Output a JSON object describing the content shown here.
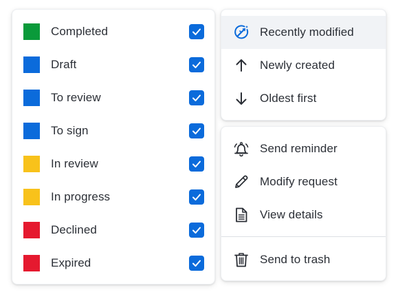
{
  "colors": {
    "green": "#0a9a3a",
    "blue": "#0b6bdb",
    "yellow": "#f8c21b",
    "red": "#e5192f",
    "checkbox": "#0b6bdb"
  },
  "status_filters": [
    {
      "label": "Completed",
      "color": "green",
      "checked": true
    },
    {
      "label": "Draft",
      "color": "blue",
      "checked": true
    },
    {
      "label": "To review",
      "color": "blue",
      "checked": true
    },
    {
      "label": "To sign",
      "color": "blue",
      "checked": true
    },
    {
      "label": "In review",
      "color": "yellow",
      "checked": true
    },
    {
      "label": "In progress",
      "color": "yellow",
      "checked": true
    },
    {
      "label": "Declined",
      "color": "red",
      "checked": true
    },
    {
      "label": "Expired",
      "color": "red",
      "checked": true
    }
  ],
  "sort_menu": {
    "items": [
      {
        "label": "Recently modified",
        "icon": "magic-wand-icon",
        "selected": true
      },
      {
        "label": "Newly created",
        "icon": "arrow-up-icon",
        "selected": false
      },
      {
        "label": "Oldest first",
        "icon": "arrow-down-icon",
        "selected": false
      }
    ]
  },
  "actions_menu": {
    "items": [
      {
        "label": "Send reminder",
        "icon": "bell-icon"
      },
      {
        "label": "Modify request",
        "icon": "pencil-icon"
      },
      {
        "label": "View details",
        "icon": "document-icon"
      },
      {
        "label": "Send to trash",
        "icon": "trash-icon"
      }
    ]
  }
}
